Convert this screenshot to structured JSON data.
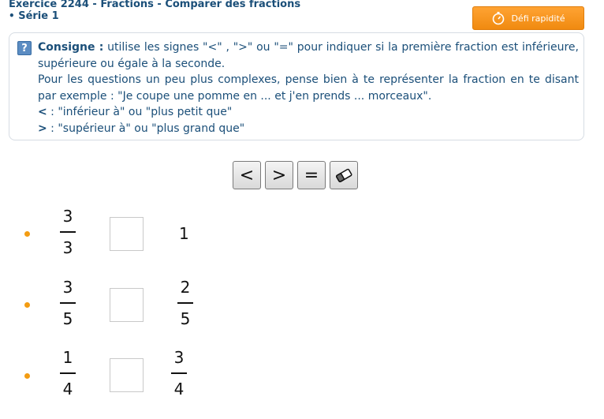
{
  "header": {
    "title": "Exercice 2244 - Fractions - Comparer des fractions",
    "series_bullet": "•",
    "series": "Série 1"
  },
  "defi_button": {
    "label": "Défi rapidité",
    "icon": "stopwatch-icon"
  },
  "consigne": {
    "icon": "help-question-icon",
    "icon_glyph": "?",
    "label": "Consigne :",
    "line1": " utilise les signes \"<\" , \">\" ou \"=\" pour indiquer si la première fraction est inférieure, supérieure ou égale à la seconde.",
    "line2": "Pour les questions un peu plus complexes, pense bien à te représenter la fraction en te disant par exemple : \"Je coupe une pomme en ... et j'en prends ... morceaux\".",
    "lt_symbol": "<",
    "lt_text": " : \"inférieur à\" ou \"plus petit que\"",
    "gt_symbol": ">",
    "gt_text": " : \"supérieur à\" ou \"plus grand que\""
  },
  "toolbar": {
    "less_label": "<",
    "greater_label": ">",
    "equal_label": "=",
    "eraser_icon": "eraser-icon"
  },
  "questions": [
    {
      "left_num": "3",
      "left_den": "3",
      "answer": "",
      "right_whole": "1"
    },
    {
      "left_num": "3",
      "left_den": "5",
      "answer": "",
      "right_num": "2",
      "right_den": "5"
    },
    {
      "left_num": "1",
      "left_den": "4",
      "answer": "",
      "right_num": "3",
      "right_den": "4"
    }
  ],
  "colors": {
    "title": "#1b4f79",
    "accent_orange": "#f39c12",
    "button_orange": "#f7921e"
  }
}
